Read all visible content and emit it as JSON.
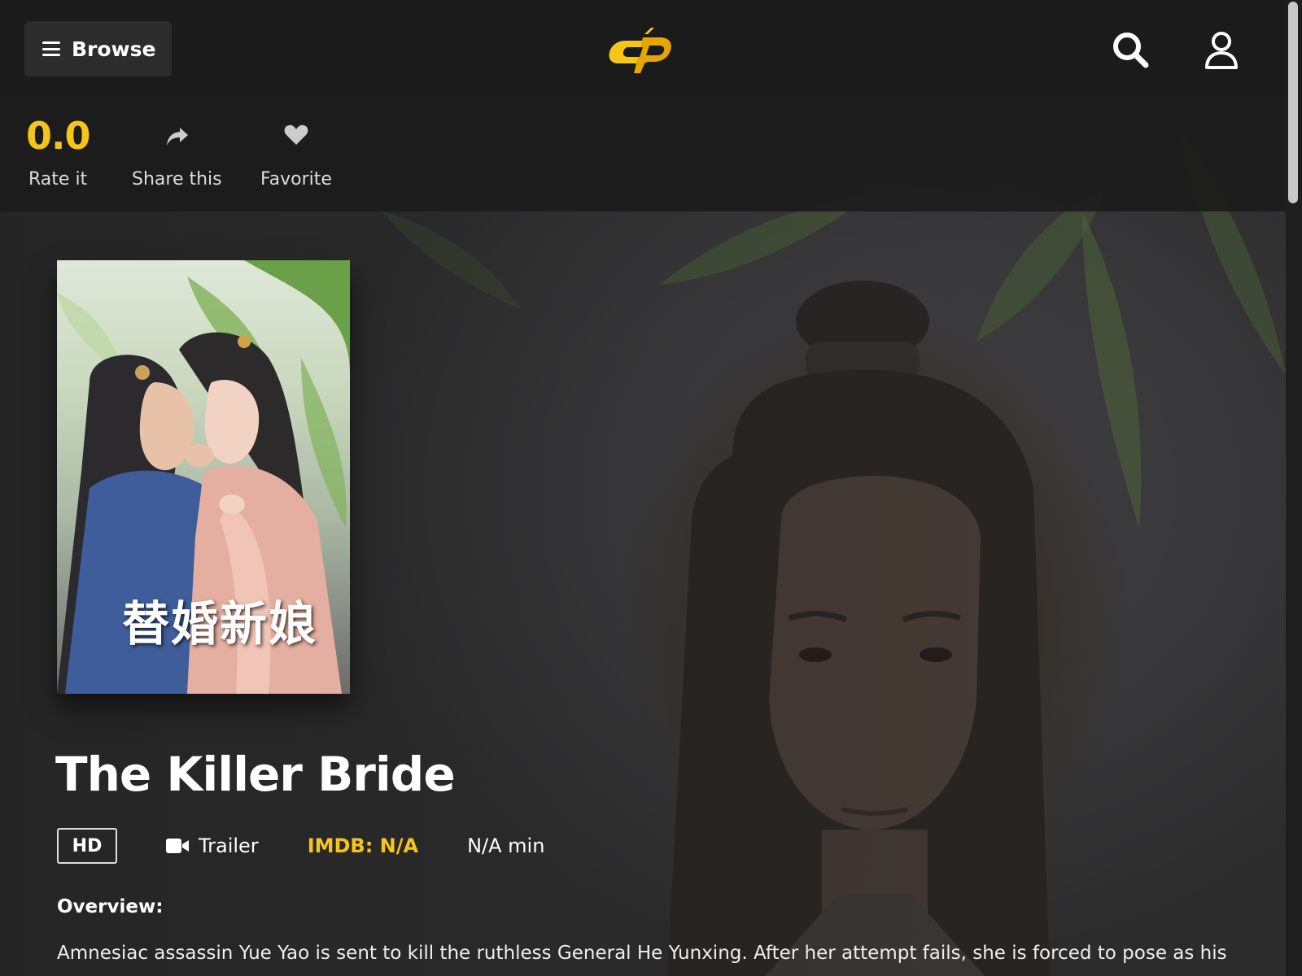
{
  "header": {
    "browse_label": "Browse",
    "logo_text": "dp",
    "colors": {
      "bar": "#1b1b1b",
      "accent": "#f5c518"
    }
  },
  "actions": {
    "rating_value": "0.0",
    "rate_label": "Rate it",
    "share_label": "Share this",
    "favorite_label": "Favorite"
  },
  "movie": {
    "poster_title_cjk": "替婚新娘",
    "title": "The Killer Bride",
    "quality": "HD",
    "trailer_label": "Trailer",
    "imdb": "IMDB: N/A",
    "runtime": "N/A min",
    "overview_label": "Overview:",
    "overview_text": "Amnesiac assassin Yue Yao is sent to kill the ruthless General He Yunxing. After her attempt fails, she is forced to pose as his"
  },
  "icons": {
    "menu": "hamburger-icon",
    "search": "search-icon",
    "user": "user-icon",
    "share": "share-icon",
    "favorite": "heart-icon",
    "trailer": "video-camera-icon"
  }
}
